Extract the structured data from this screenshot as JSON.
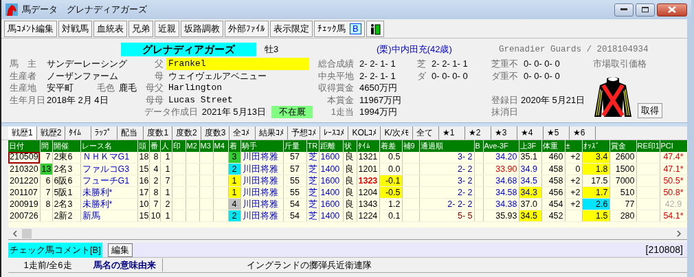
{
  "window": {
    "title": "馬データ　グレナディアガーズ"
  },
  "toolbar": [
    {
      "label": "馬ｺﾒﾝﾄ編集"
    },
    {
      "label": "対戦馬"
    },
    {
      "label": "血統表"
    },
    {
      "label": "兄弟"
    },
    {
      "label": "近親"
    },
    {
      "label": "坂路調教"
    },
    {
      "label": "外部ﾌｧｲﾙ"
    },
    {
      "label": "表示限定"
    },
    {
      "label": "ﾁｪｯｸ馬",
      "badge": "B"
    }
  ],
  "horse": {
    "name": "グレナディアガーズ",
    "sex_age": "牡3",
    "trainer": "(栗)中内田充(42歳)",
    "english": "Grenadier Guards / 2018104934"
  },
  "details": [
    {
      "label": "馬　主",
      "value": "サンデーレーシング"
    },
    {
      "label": "生産者",
      "value": "ノーザンファーム"
    },
    {
      "label": "生産地",
      "value": "安平町",
      "extra": {
        "label": "毛色",
        "value": "鹿毛"
      }
    },
    {
      "label": "生年月日",
      "value": "2018年 2月 4日"
    }
  ],
  "pedigree": [
    {
      "label": "父",
      "value": "Frankel",
      "highlight": true
    },
    {
      "label": "母",
      "value": "ウェイヴェルアベニュー",
      "highlight": false
    },
    {
      "label": "母父",
      "value": "Harlington",
      "highlight": false
    },
    {
      "label": "母母",
      "value": "Lucas Street",
      "highlight": false
    }
  ],
  "data_date": {
    "label": "データ作成日",
    "value": "2021年 5月13日",
    "status": "不在厩"
  },
  "records": [
    {
      "label": "総合成績",
      "value": "2- 2- 1- 1"
    },
    {
      "label": "中央平地",
      "value": "2- 2- 1- 1"
    },
    {
      "label": "収得賞金",
      "value": "4650万円"
    },
    {
      "label": "本賞金",
      "value": "11967万円"
    },
    {
      "label": "1走当",
      "value": "1994万円"
    }
  ],
  "surface": [
    {
      "label": "芝",
      "value": "2- 2- 1- 1"
    },
    {
      "label": "ダ",
      "value": "0- 0- 0- 0"
    }
  ],
  "heavy": [
    {
      "label": "芝重不",
      "value": "0- 0- 0- 0"
    },
    {
      "label": "ダ重不",
      "value": "0- 0- 0- 0"
    }
  ],
  "market": {
    "label": "市場取引価格"
  },
  "registration": [
    {
      "label": "登録日",
      "value": "2020年 5月21日"
    },
    {
      "label": "抹消日"
    }
  ],
  "get_button": "取得",
  "tabs": [
    {
      "label": "戦歴1",
      "selected": true
    },
    {
      "label": "戦歴2",
      "selected": false
    },
    {
      "label": "ﾀｲﾑ",
      "selected": false
    },
    {
      "label": "ﾗｯﾌﾟ",
      "selected": false
    },
    {
      "label": "配当",
      "selected": false
    },
    {
      "label": "度数1",
      "selected": false
    },
    {
      "label": "度数2",
      "selected": false
    },
    {
      "label": "度数3",
      "selected": false
    },
    {
      "label": "全ｺﾒ",
      "selected": false
    },
    {
      "label": "結果ｺﾒ",
      "selected": false
    },
    {
      "label": "予想ｺﾒ",
      "selected": false
    },
    {
      "label": "ﾚｰｽｺﾒ",
      "selected": false
    },
    {
      "label": "KOLｺﾒ",
      "selected": false
    },
    {
      "label": "K/次ﾒﾓ",
      "selected": false
    },
    {
      "label": "全て",
      "selected": false
    },
    {
      "label": "★1",
      "selected": false
    },
    {
      "label": "★2",
      "selected": false
    },
    {
      "label": "★3",
      "selected": false
    },
    {
      "label": "★4",
      "selected": false
    },
    {
      "label": "★5",
      "selected": false
    },
    {
      "label": "★6",
      "selected": false
    }
  ],
  "table": {
    "columns": [
      "日付",
      "間",
      "開催",
      "レース名",
      "頭",
      "番",
      "人",
      "印",
      "M2",
      "M3",
      "M4",
      "着",
      "騎手",
      "斤量",
      "TR",
      "距離",
      "状",
      "ﾀｲﾑ",
      "着差",
      "補9",
      "通過順",
      "B",
      "Ave-3F",
      "上3F",
      "体重",
      "±",
      "ｵｯｽﾞ",
      "賞金",
      "RE印1",
      "PCI"
    ],
    "rows": [
      {
        "selected": true,
        "cells": [
          "210509",
          "7",
          "2東6",
          "ＮＨＫマG1",
          "18",
          "8",
          "1",
          null,
          null,
          null,
          null,
          {
            "text": "3",
            "color": "#33cc33"
          },
          "川田将雅",
          "57",
          "芝",
          "1600",
          "良",
          "1321",
          "0.5",
          null,
          "3- 2",
          null,
          "34.20",
          "35.1",
          "460",
          "+2",
          {
            "text": "3.4",
            "color": "#ffff00"
          },
          "2600",
          null,
          "47.4*"
        ]
      },
      {
        "selected": false,
        "cells": [
          "210320",
          {
            "text": "13",
            "color": "#33cc33"
          },
          "2名3",
          "ファルコG3",
          "15",
          "4",
          "1",
          null,
          null,
          null,
          null,
          {
            "text": "2",
            "color": "#00e5f0"
          },
          "川田将雅",
          "57",
          "芝",
          "1400",
          "良",
          "1201",
          "0.0",
          null,
          "2- 2",
          null,
          {
            "text": "33.90",
            "kind": "best"
          },
          {
            "text": "34.9",
            "kind": "fast"
          },
          "458",
          "0",
          {
            "text": "1.8",
            "color": "#ffff00"
          },
          "1500",
          null,
          "47.1*"
        ]
      },
      {
        "selected": false,
        "cells": [
          "201220",
          "6",
          "6阪6",
          "フューチG1",
          "16",
          "2",
          "7",
          null,
          null,
          null,
          null,
          {
            "text": "1",
            "color": "#ffff00"
          },
          "川田将雅",
          "55",
          "芝",
          "1600",
          "良",
          {
            "text": "1323",
            "kind": "record"
          },
          {
            "text": "-0.1",
            "color": "#ffff00"
          },
          null,
          "3- 2",
          null,
          "34.68",
          {
            "text": "34.5",
            "kind": "fast"
          },
          "458",
          "+2",
          "17.5",
          "7000",
          null,
          "50.5*"
        ]
      },
      {
        "selected": false,
        "cells": [
          "201107",
          "7",
          "5阪1",
          "未勝利*",
          "17",
          "8",
          "1",
          null,
          null,
          null,
          null,
          {
            "text": "1",
            "color": "#ffff00"
          },
          "川田将雅",
          "55",
          "芝",
          "1400",
          "良",
          "1204",
          {
            "text": "-0.5",
            "color": "#ffff00"
          },
          null,
          "2- 2",
          null,
          "34.58",
          {
            "text": "34.3",
            "kind": "fast",
            "color": "#ffff00"
          },
          "456",
          "+2",
          {
            "text": "1.7",
            "color": "#ffff00"
          },
          "510",
          null,
          "50.8*"
        ]
      },
      {
        "selected": false,
        "cells": [
          "200919",
          "8",
          "2名3",
          "未勝利*",
          "10",
          "7",
          "2",
          null,
          null,
          null,
          null,
          {
            "text": "4",
            "color": "#c0c0c0"
          },
          "川田将雅",
          "54",
          "芝",
          "1600",
          "良",
          "1343",
          "1.2",
          null,
          "2- 2- 2",
          null,
          "34.38",
          "37.0",
          "454",
          "+2",
          {
            "text": "2.6",
            "color": "#00e5ff"
          },
          "77",
          null,
          {
            "text": "42.9",
            "kind": "muted"
          }
        ]
      },
      {
        "selected": false,
        "cells": [
          "200726",
          null,
          "2新2",
          "新馬",
          "15",
          "10",
          "1",
          null,
          null,
          null,
          null,
          {
            "text": "2",
            "color": "#00e5f0"
          },
          "川田将雅",
          "54",
          "芝",
          "1400",
          "良",
          "1224",
          "0.1",
          null,
          {
            "text": "5- 5",
            "kind": "late"
          },
          null,
          {
            "text": "35.93",
            "kind": "plain"
          },
          {
            "text": "34.5",
            "color": "#ffff00"
          },
          "452",
          null,
          {
            "text": "1.5",
            "color": "#ffff00"
          },
          "280",
          null,
          "54.1*"
        ]
      }
    ]
  },
  "comment_bar": {
    "label": "チェック馬コメント[B]",
    "edit": "編集",
    "date": "[210808]"
  },
  "footer": {
    "runs": "1走前/全6走",
    "label": "馬名の意味由来",
    "text": "イングランドの擲弾兵近衛連隊"
  }
}
